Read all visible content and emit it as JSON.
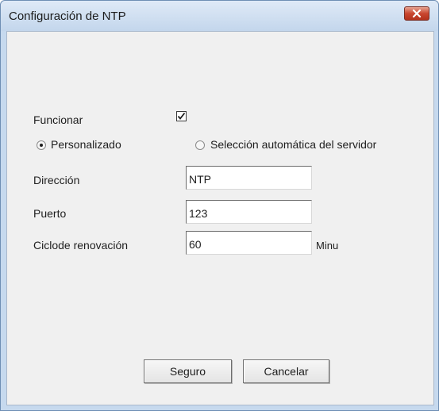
{
  "window": {
    "title": "Configuración de NTP"
  },
  "form": {
    "enable_label": "Funcionar",
    "enable_checked": true,
    "radio_custom_label": "Personalizado",
    "radio_custom_selected": true,
    "radio_auto_label": "Selección automática del servidor",
    "radio_auto_selected": false,
    "address_label": "Dirección",
    "address_value": "NTP",
    "port_label": "Puerto",
    "port_value": "123",
    "renewal_label": "Ciclode renovación",
    "renewal_value": "60",
    "renewal_unit": "Minu"
  },
  "buttons": {
    "ok_label": "Seguro",
    "cancel_label": "Cancelar"
  },
  "icons": {
    "close": "close-icon",
    "check": "checkmark-icon"
  },
  "colors": {
    "titlebar": "#c6d9ee",
    "client": "#f0f0f0",
    "close_button": "#c9462f"
  }
}
